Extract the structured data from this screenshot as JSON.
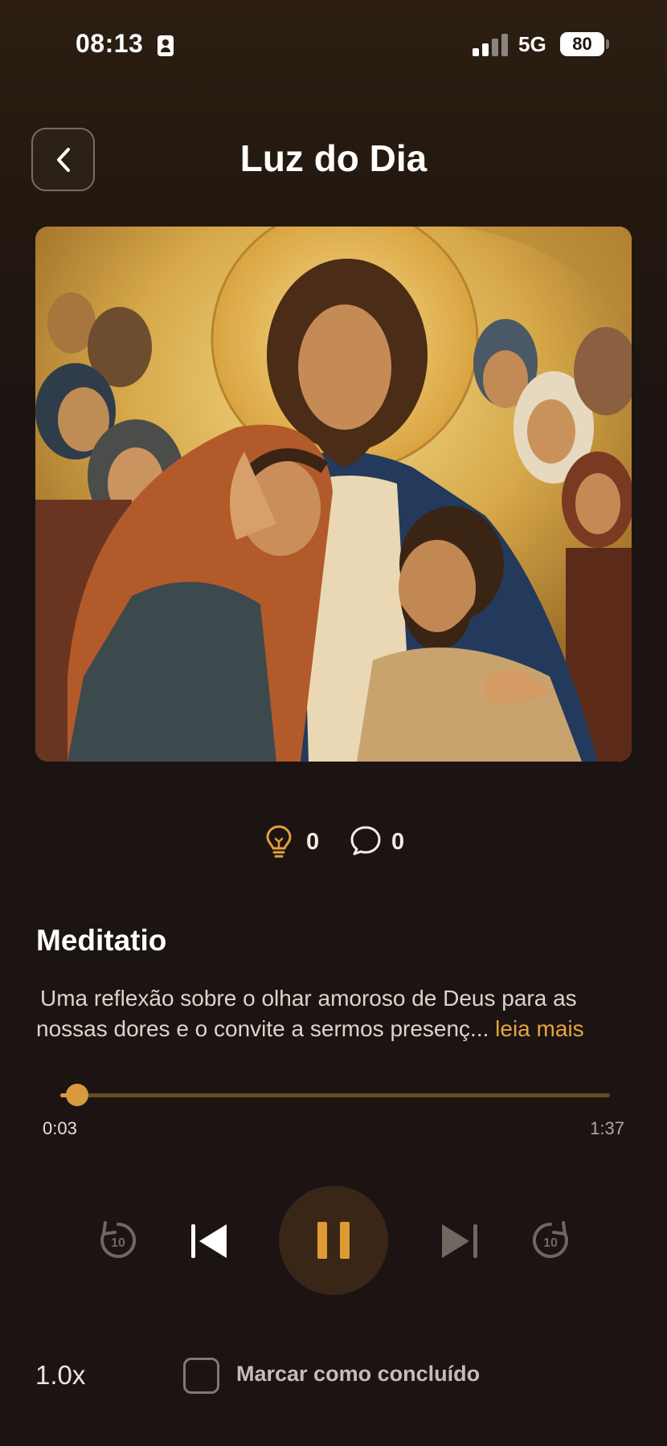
{
  "status_bar": {
    "time": "08:13",
    "network": "5G",
    "battery": "80"
  },
  "header": {
    "title": "Luz do Dia",
    "back_icon": "chevron-left-icon"
  },
  "artwork": {
    "icon": "religious-painting"
  },
  "stats": {
    "insights_icon": "lightbulb-icon",
    "insights_count": "0",
    "comments_icon": "comment-bubble-icon",
    "comments_count": "0"
  },
  "section": {
    "title": "Meditatio",
    "description_line1": "Uma reflexão sobre o olhar amoroso de Deus para as",
    "description_line2": "nossas dores e o convite a sermos presenç...",
    "read_more": "leia mais"
  },
  "player": {
    "progress_fraction": 0.03,
    "current_time": "0:03",
    "total_time": "1:37",
    "rewind_label": "10",
    "forward_label": "10",
    "state": "playing"
  },
  "footer": {
    "speed": "1.0x",
    "complete_label": "Marcar como concluído",
    "completed": false
  },
  "colors": {
    "accent": "#d79a3c",
    "background": "#1b1413"
  }
}
